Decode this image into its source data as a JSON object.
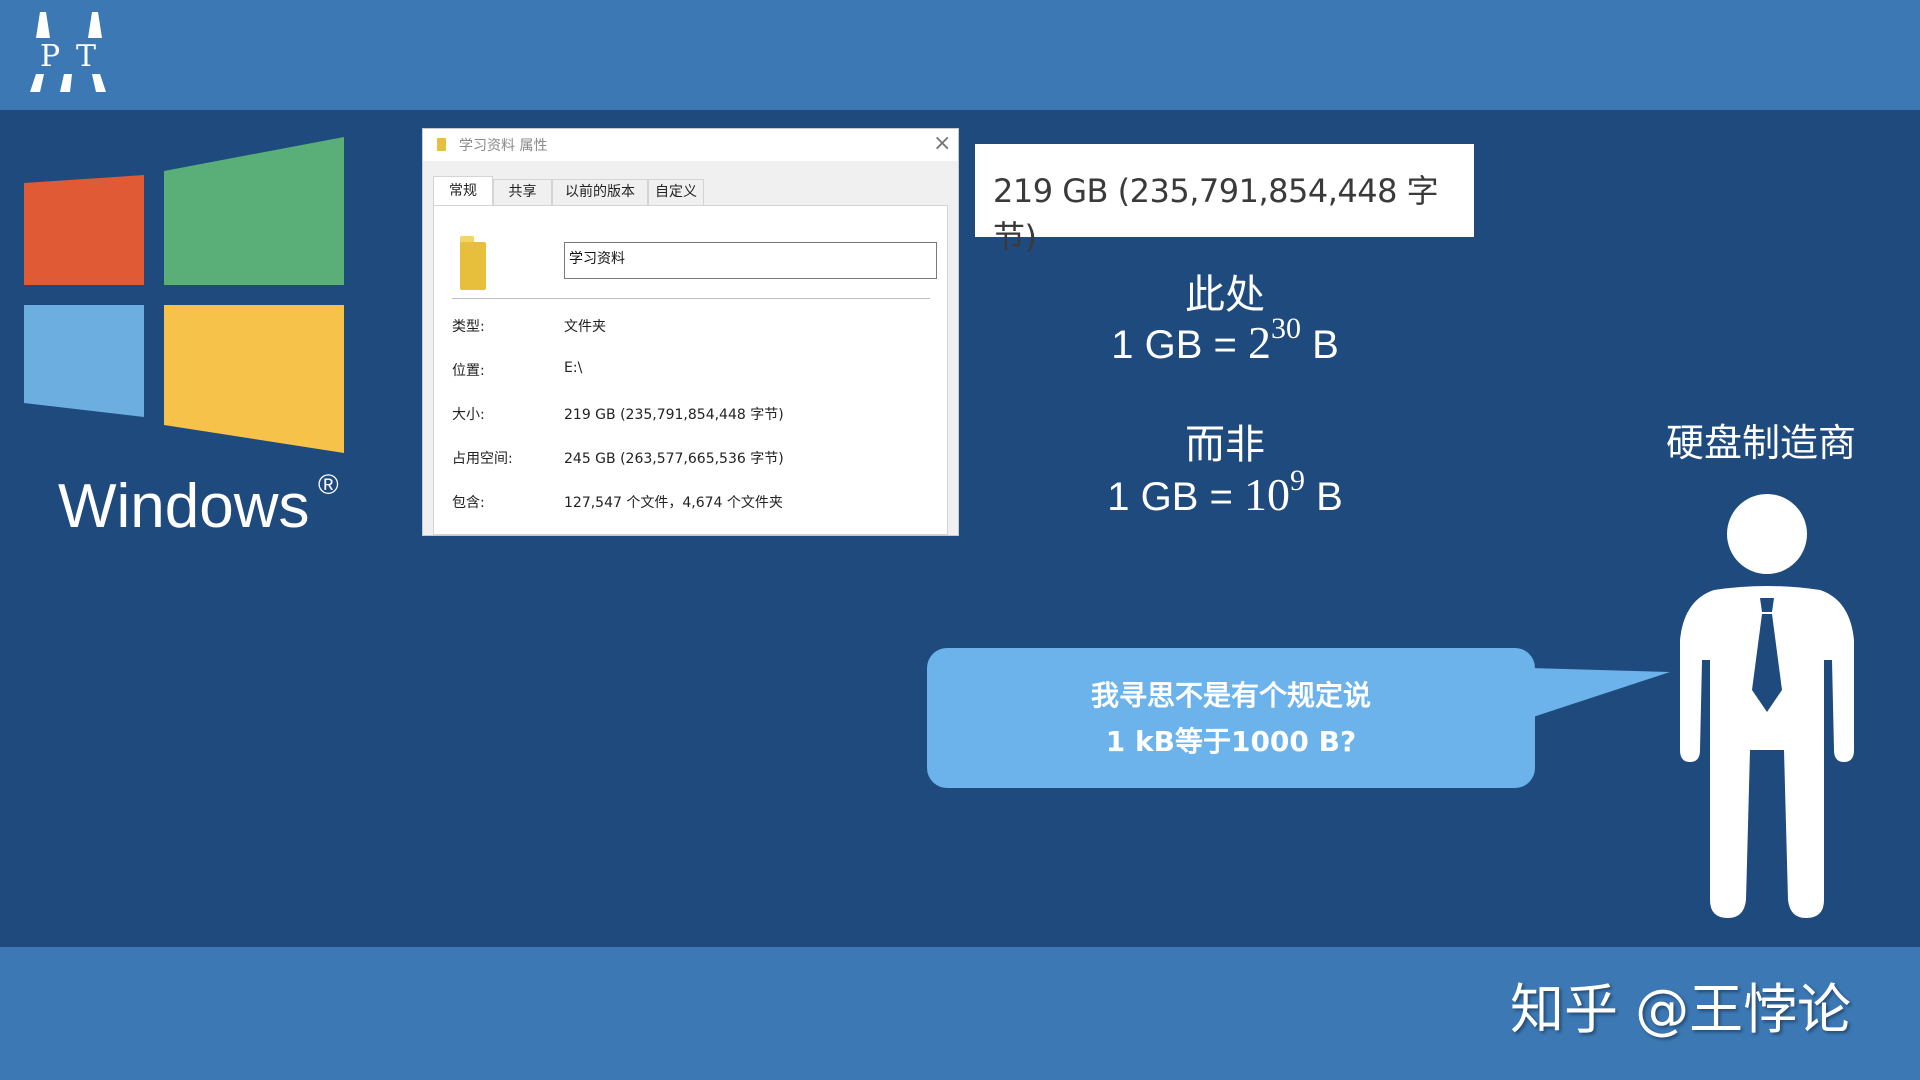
{
  "logo": {
    "top_letters": "AA",
    "left": "P",
    "right": "T"
  },
  "windows": {
    "brand": "Windows",
    "reg": "®",
    "colors": {
      "red": "#e05a36",
      "green": "#5aaf78",
      "blue": "#6caedf",
      "yellow": "#f6c24a"
    }
  },
  "dialog": {
    "title": "学习资料 属性",
    "tabs": [
      "常规",
      "共享",
      "以前的版本",
      "自定义"
    ],
    "name_value": "学习资料",
    "props": [
      {
        "label": "类型:",
        "value": "文件夹"
      },
      {
        "label": "位置:",
        "value": "E:\\"
      },
      {
        "label": "大小:",
        "value": "219 GB (235,791,854,448 字节)"
      },
      {
        "label": "占用空间:",
        "value": "245 GB (263,577,665,536 字节)"
      },
      {
        "label": "包含:",
        "value": "127,547 个文件，4,674 个文件夹"
      }
    ]
  },
  "size_zoom": "219 GB (235,791,854,448 字节)",
  "annotation": {
    "here": "此处",
    "eq1_prefix": "1 GB = ",
    "eq1_base": "2",
    "eq1_exp": "30",
    "eq1_suffix": " B",
    "not": "而非",
    "eq2_prefix": "1 GB = ",
    "eq2_base": "10",
    "eq2_exp": "9",
    "eq2_suffix": " B"
  },
  "bubble": {
    "line1": "我寻思不是有个规定说",
    "line2": "1 kB等于1000 B?"
  },
  "maker_label": "硬盘制造商",
  "credit": "知乎 @王悖论"
}
